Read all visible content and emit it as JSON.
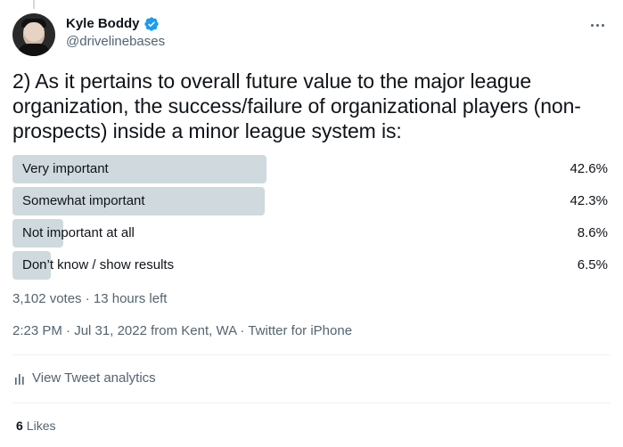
{
  "tweet": {
    "author": {
      "display_name": "Kyle Boddy",
      "handle": "@drivelinebases",
      "verified": true
    },
    "text": "2) As it pertains to overall future value to the major league organization, the success/failure of organizational players (non-prospects) inside a minor league system is:",
    "poll": {
      "options": [
        {
          "label": "Very important",
          "percent": "42.6%",
          "value": 42.6
        },
        {
          "label": "Somewhat important",
          "percent": "42.3%",
          "value": 42.3
        },
        {
          "label": "Not important at all",
          "percent": "8.6%",
          "value": 8.6
        },
        {
          "label": "Don’t know / show results",
          "percent": "6.5%",
          "value": 6.5
        }
      ],
      "meta": "3,102 votes · 13 hours left"
    },
    "timestamp": {
      "time": "2:23 PM",
      "sep1": " · ",
      "date": "Jul 31, 2022",
      "location": " from Kent, WA",
      "sep2": " · ",
      "client": "Twitter for iPhone"
    },
    "analytics_label": "View Tweet analytics",
    "likes": {
      "count": "6",
      "label": "Likes"
    }
  },
  "colors": {
    "poll_bar": "#cfd9de",
    "verified": "#1d9bf0",
    "secondary_text": "#536471"
  },
  "icons": {
    "verified": "verified-badge-icon",
    "more": "more-options-icon",
    "analytics": "bar-chart-icon"
  }
}
